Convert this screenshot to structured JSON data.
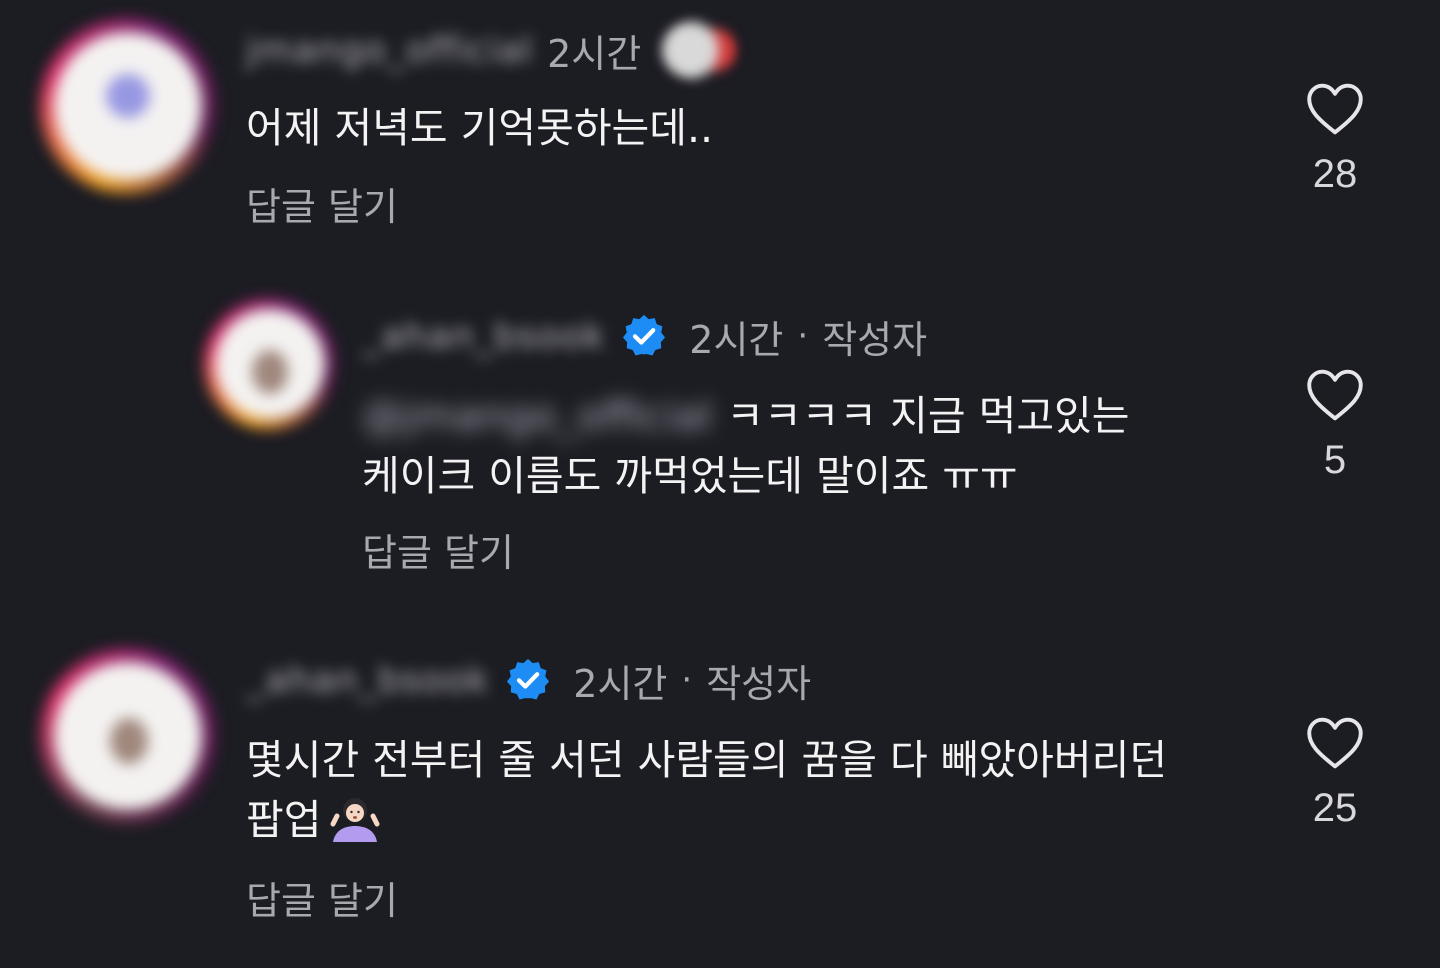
{
  "comments": [
    {
      "username": "jmango_official",
      "time": "2시간",
      "text_lines": [
        "어제 저녁도 기억못하는데.."
      ],
      "reply_label": "답글 달기",
      "like_count": "28"
    },
    {
      "username": "_ahan_bsook",
      "time": "2시간",
      "separator": "·",
      "author_badge": "작성자",
      "mention": "@jmango_official",
      "text_line1": "ㅋㅋㅋㅋ 지금 먹고있는",
      "text_line2": "케이크 이름도 까먹었는데 말이죠 ㅠㅠ",
      "reply_label": "답글 달기",
      "like_count": "5"
    },
    {
      "username": "_ahan_bsook",
      "time": "2시간",
      "separator": "·",
      "author_badge": "작성자",
      "text_line1": "몇시간 전부터 줄 서던 사람들의 꿈을 다 빼았아버리던",
      "text_line2": "팝업",
      "emoji": "woman-shrugging",
      "reply_label": "답글 달기",
      "like_count": "25"
    }
  ],
  "icons": {
    "like": "heart-outline-icon",
    "verified": "verified-badge-icon"
  },
  "colors": {
    "background": "#1c1c23",
    "verified": "#1d8df5",
    "secondary_text": "#a8a8b0"
  }
}
